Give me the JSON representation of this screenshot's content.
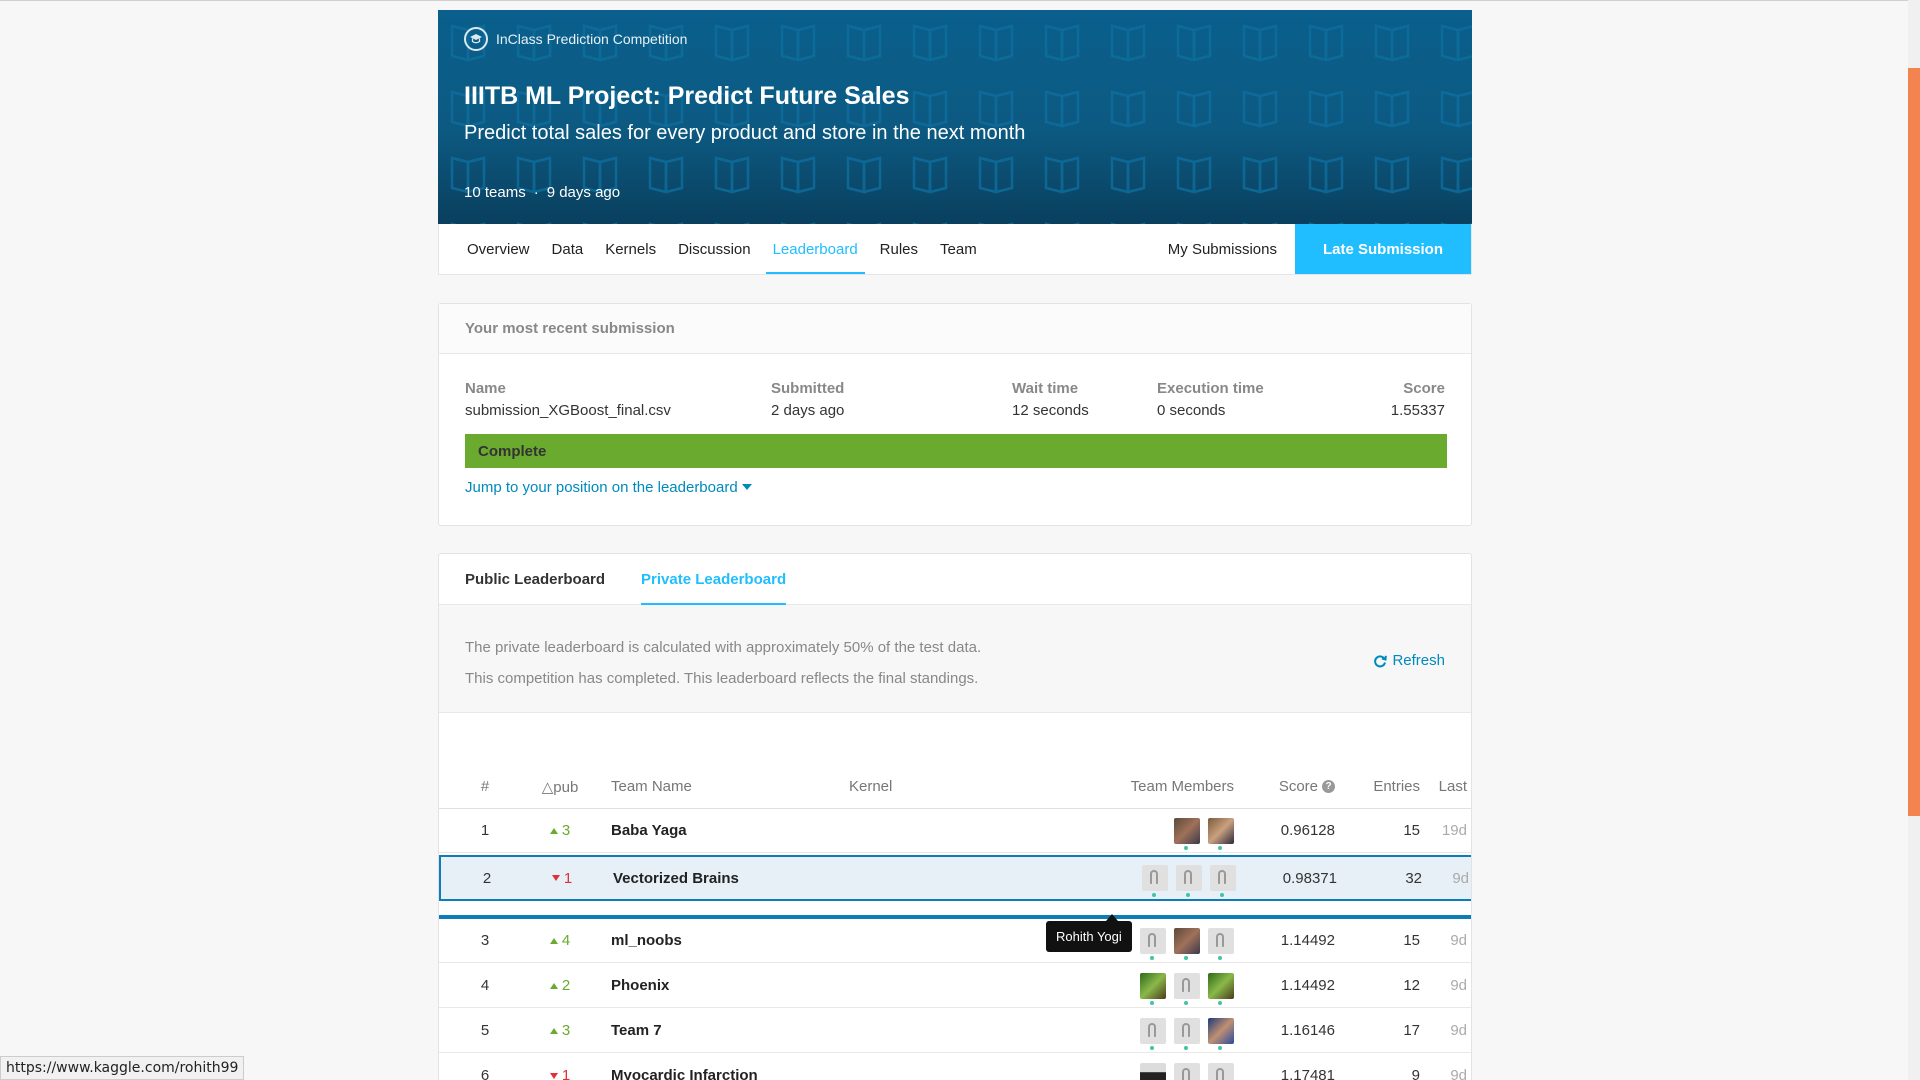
{
  "banner": {
    "kind": "InClass Prediction Competition",
    "title": "IIITB ML Project: Predict Future Sales",
    "subtitle": "Predict total sales for every product and store in the next month",
    "teams": "10 teams",
    "separator": "·",
    "age": "9 days ago"
  },
  "nav": {
    "items": [
      "Overview",
      "Data",
      "Kernels",
      "Discussion",
      "Leaderboard",
      "Rules",
      "Team"
    ],
    "active": "Leaderboard",
    "my_submissions": "My Submissions",
    "late_submission": "Late Submission"
  },
  "submission": {
    "heading": "Your most recent submission",
    "name_label": "Name",
    "name_value": "submission_XGBoost_final.csv",
    "submitted_label": "Submitted",
    "submitted_value": "2 days ago",
    "wait_label": "Wait time",
    "wait_value": "12 seconds",
    "exec_label": "Execution time",
    "exec_value": "0 seconds",
    "score_label": "Score",
    "score_value": "1.55337",
    "status": "Complete",
    "jump_link": "Jump to your position on the leaderboard"
  },
  "leaderboard": {
    "tabs": [
      "Public Leaderboard",
      "Private Leaderboard"
    ],
    "active_tab": "Private Leaderboard",
    "info_line1": "The private leaderboard is calculated with approximately 50% of the test data.",
    "info_line2": "This competition has completed. This leaderboard reflects the final standings.",
    "refresh": "Refresh",
    "columns": {
      "rank": "#",
      "delta": "△pub",
      "team": "Team Name",
      "kernel": "Kernel",
      "members": "Team Members",
      "score": "Score",
      "entries": "Entries",
      "last": "Last"
    },
    "rows": [
      {
        "rank": "1",
        "delta": "3",
        "dir": "up",
        "team": "Baba Yaga",
        "score": "0.96128",
        "entries": "15",
        "last": "19d"
      },
      {
        "rank": "2",
        "delta": "1",
        "dir": "down",
        "team": "Vectorized Brains",
        "score": "0.98371",
        "entries": "32",
        "last": "9d"
      },
      {
        "rank": "3",
        "delta": "4",
        "dir": "up",
        "team": "ml_noobs",
        "score": "1.14492",
        "entries": "15",
        "last": "9d"
      },
      {
        "rank": "4",
        "delta": "2",
        "dir": "up",
        "team": "Phoenix",
        "score": "1.14492",
        "entries": "12",
        "last": "9d"
      },
      {
        "rank": "5",
        "delta": "3",
        "dir": "up",
        "team": "Team 7",
        "score": "1.16146",
        "entries": "17",
        "last": "9d"
      },
      {
        "rank": "6",
        "delta": "1",
        "dir": "down",
        "team": "Myocardic Infarction",
        "score": "1.17481",
        "entries": "9",
        "last": "9d"
      }
    ],
    "tooltip": "Rohith Yogi"
  },
  "statusbar": {
    "url": "https://www.kaggle.com/rohith99"
  },
  "colors": {
    "accent": "#20beff",
    "link": "#008abc",
    "complete": "#6aaa2f",
    "up": "#6aaa2f",
    "down": "#e0303a",
    "scroll": "#f4844f"
  }
}
